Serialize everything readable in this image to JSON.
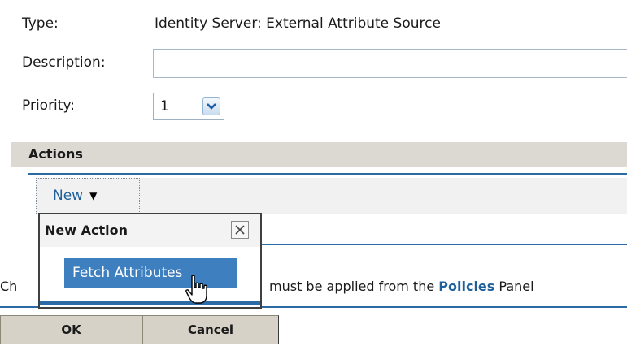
{
  "form": {
    "type_label": "Type:",
    "type_value": "Identity Server: External Attribute Source",
    "description_label": "Description:",
    "description_value": "",
    "priority_label": "Priority:",
    "priority_value": "1"
  },
  "actions": {
    "section_title": "Actions",
    "new_button_label": "New",
    "new_button_arrow": "▼"
  },
  "popup": {
    "title": "New Action",
    "close_glyph": "✕",
    "items": [
      "Fetch Attributes"
    ]
  },
  "note": {
    "prefix": "Ch",
    "text": "must be applied from the ",
    "link": "Policies",
    "suffix": " Panel"
  },
  "buttons": {
    "ok": "OK",
    "cancel": "Cancel"
  },
  "colors": {
    "accent": "#2c6aa6",
    "menu_highlight": "#3d7fbf",
    "section_bar": "#dcd9d2"
  },
  "icons": {
    "dropdown": "chevron-down-icon",
    "close": "close-icon",
    "cursor": "hand-pointer-icon"
  }
}
